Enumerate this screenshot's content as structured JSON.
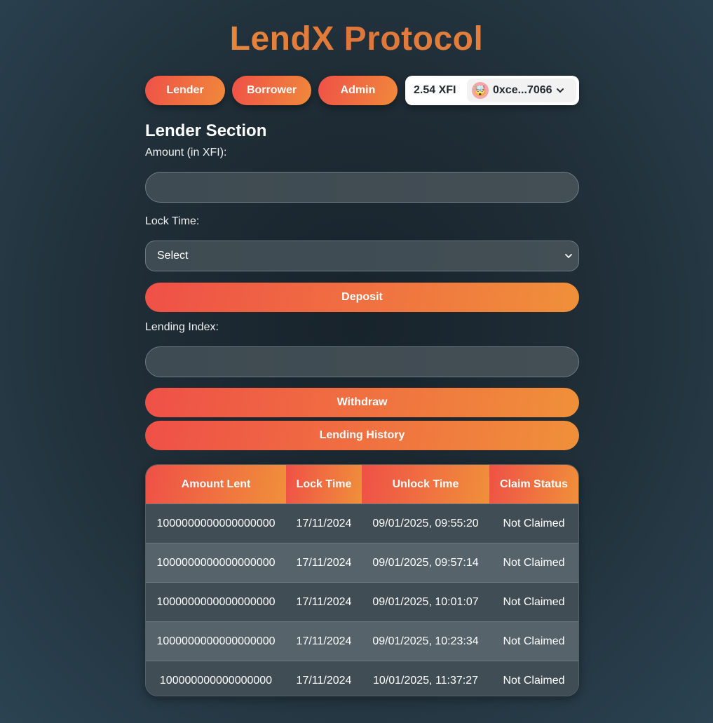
{
  "app_title": "LendX Protocol",
  "nav": {
    "lender": "Lender",
    "borrower": "Borrower",
    "admin": "Admin"
  },
  "wallet": {
    "balance": "2.54 XFI",
    "avatar_emoji": "🤯",
    "address": "0xce...7066"
  },
  "lender_section": {
    "title": "Lender Section",
    "amount_label": "Amount (in XFI):",
    "amount_value": "",
    "lock_time_label": "Lock Time:",
    "lock_time_selected": "Select",
    "deposit_label": "Deposit",
    "lending_index_label": "Lending Index:",
    "lending_index_value": "",
    "withdraw_label": "Withdraw",
    "history_label": "Lending History"
  },
  "history_table": {
    "headers": [
      "Amount Lent",
      "Lock Time",
      "Unlock Time",
      "Claim Status"
    ],
    "rows": [
      [
        "1000000000000000000",
        "17/11/2024",
        "09/01/2025, 09:55:20",
        "Not Claimed"
      ],
      [
        "1000000000000000000",
        "17/11/2024",
        "09/01/2025, 09:57:14",
        "Not Claimed"
      ],
      [
        "1000000000000000000",
        "17/11/2024",
        "09/01/2025, 10:01:07",
        "Not Claimed"
      ],
      [
        "1000000000000000000",
        "17/11/2024",
        "09/01/2025, 10:23:34",
        "Not Claimed"
      ],
      [
        "100000000000000000",
        "17/11/2024",
        "10/01/2025, 11:37:27",
        "Not Claimed"
      ]
    ]
  },
  "colors": {
    "accent_start": "#ef5047",
    "accent_end": "#f0903a",
    "title_gradient": "#e8913a"
  }
}
